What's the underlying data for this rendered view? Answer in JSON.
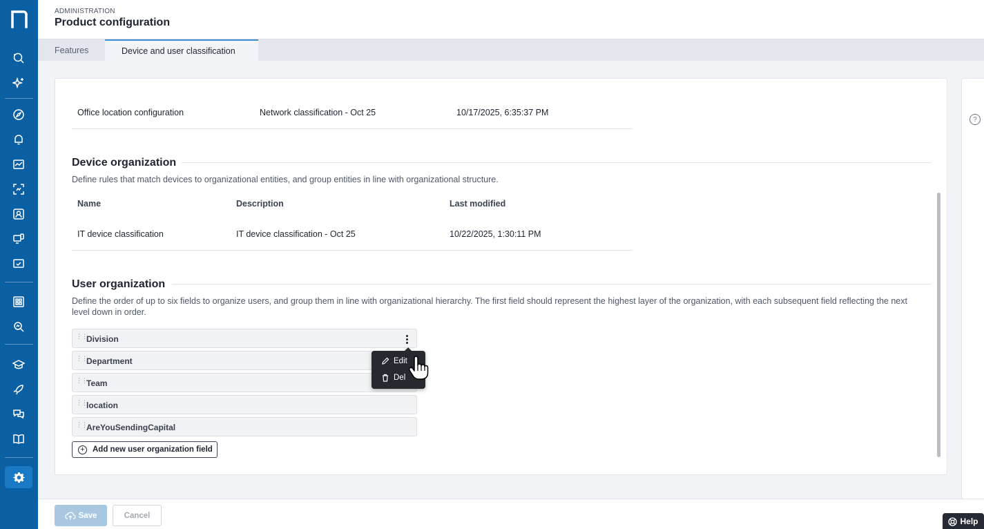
{
  "header": {
    "eyebrow": "ADMINISTRATION",
    "title": "Product configuration"
  },
  "tabs": [
    {
      "label": "Features",
      "active": false
    },
    {
      "label": "Device and user classification",
      "active": true
    }
  ],
  "network_row": {
    "name": "Office location configuration",
    "description": "Network classification - Oct 25",
    "modified": "10/17/2025, 6:35:37 PM"
  },
  "device_org": {
    "title": "Device organization",
    "description": "Define rules that match devices to organizational entities, and group entities in line with organizational structure.",
    "columns": [
      "Name",
      "Description",
      "Last modified"
    ],
    "rows": [
      {
        "name": "IT device classification",
        "description": "IT device classification - Oct 25",
        "modified": "10/22/2025, 1:30:11 PM"
      }
    ]
  },
  "user_org": {
    "title": "User organization",
    "description": "Define the order of up to six fields to organize users, and group them in line with organizational hierarchy. The first field should represent the highest layer of the organization, with each subsequent field reflecting the next level down in order.",
    "fields": [
      "Division",
      "Department",
      "Team",
      "location",
      "AreYouSendingCapital"
    ],
    "add_label": "Add new user organization field"
  },
  "context_menu": {
    "edit_label": "Edit",
    "delete_label": "Del"
  },
  "footer": {
    "save_label": "Save",
    "cancel_label": "Cancel",
    "help_label": "Help"
  },
  "colors": {
    "sidebar": "#0b5fa3",
    "sidebar_active": "#1a79c4",
    "tab_accent": "#3b8fd6",
    "save_disabled": "#a8c8e2"
  },
  "icons": {
    "sidebar": [
      "search-icon",
      "sparkle-icon",
      "compass-icon",
      "bell-icon",
      "chart-icon",
      "scan-icon",
      "users-search-icon",
      "devices-icon",
      "monitor-check-icon",
      "grid-icon",
      "search-analytics-icon",
      "education-icon",
      "rocket-icon",
      "chat-icon",
      "book-icon",
      "gear-icon"
    ]
  }
}
